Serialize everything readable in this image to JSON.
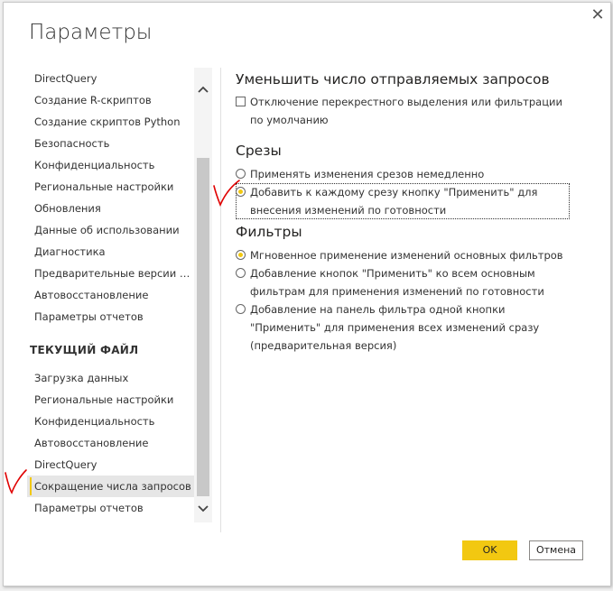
{
  "dialog": {
    "title": "Параметры",
    "close_glyph": "✕"
  },
  "nav": {
    "global_items": [
      "DirectQuery",
      "Создание R-скриптов",
      "Создание скриптов Python",
      "Безопасность",
      "Конфиденциальность",
      "Региональные настройки",
      "Обновления",
      "Данные об использовании",
      "Диагностика",
      "Предварительные версии во...",
      "Автовосстановление",
      "Параметры отчетов"
    ],
    "section_header": "ТЕКУЩИЙ ФАЙЛ",
    "file_items": [
      "Загрузка данных",
      "Региональные настройки",
      "Конфиденциальность",
      "Автовосстановление",
      "DirectQuery",
      "Сокращение числа запросов",
      "Параметры отчетов"
    ],
    "selected_item": "Сокращение числа запросов"
  },
  "content": {
    "reduce": {
      "heading": "Уменьшить число отправляемых запросов",
      "checkbox_label": "Отключение перекрестного выделения или фильтрации по умолчанию",
      "checked": false
    },
    "slicers": {
      "heading": "Срезы",
      "options": [
        "Применять изменения срезов немедленно",
        "Добавить к каждому срезу кнопку \"Применить\" для внесения изменений по готовности"
      ],
      "selected_index": 1
    },
    "filters": {
      "heading": "Фильтры",
      "options": [
        "Мгновенное применение изменений основных фильтров",
        "Добавление кнопок \"Применить\" ко всем основным фильтрам для применения изменений по готовности",
        "Добавление на панель фильтра одной кнопки \"Применить\" для применения всех изменений сразу (предварительная версия)"
      ],
      "selected_index": 0
    }
  },
  "buttons": {
    "ok": "OK",
    "cancel": "Отмена"
  },
  "colors": {
    "accent": "#f2c811",
    "annotation": "#e00000"
  },
  "icons": {
    "close": "close-icon",
    "scroll_up": "chevron-up-icon",
    "scroll_down": "chevron-down-icon"
  }
}
